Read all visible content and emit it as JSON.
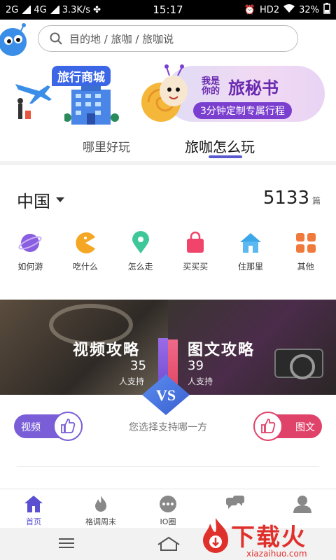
{
  "status_bar": {
    "network": "2G",
    "network2": "4G",
    "speed": "3.3K/s",
    "time": "15:17",
    "hd": "HD2",
    "battery": "32%"
  },
  "search": {
    "placeholder": "目的地 / 旅咖 / 旅咖说"
  },
  "banner": {
    "shop_label": "旅行商城",
    "secretary_small": "我是你的",
    "secretary_big": "旅秘书",
    "secretary_sub": "3分钟定制专属行程"
  },
  "tabs": [
    {
      "label": "哪里好玩",
      "active": false
    },
    {
      "label": "旅咖怎么玩",
      "active": true
    }
  ],
  "region": {
    "label": "中国",
    "count": "5133",
    "unit": "篇"
  },
  "categories": [
    {
      "label": "如何游",
      "icon": "planet-icon",
      "color": "#8a5ee0"
    },
    {
      "label": "吃什么",
      "icon": "pacman-icon",
      "color": "#f5a623"
    },
    {
      "label": "怎么走",
      "icon": "location-pin-icon",
      "color": "#3ec89a"
    },
    {
      "label": "买买买",
      "icon": "shopping-bag-icon",
      "color": "#f0446a"
    },
    {
      "label": "住那里",
      "icon": "house-icon",
      "color": "#3ba6e8"
    },
    {
      "label": "其他",
      "icon": "grid-icon",
      "color": "#f07a3c"
    }
  ],
  "versus": {
    "left_title": "视频攻略",
    "left_count": "35",
    "left_support": "人支持",
    "right_title": "图文攻略",
    "right_count": "39",
    "right_support": "人支持",
    "badge": "VS"
  },
  "choose": {
    "video_label": "视频",
    "image_label": "图文",
    "prompt": "您选择支持哪一方"
  },
  "bottom_nav": [
    {
      "label": "首页",
      "icon": "home-icon",
      "active": true
    },
    {
      "label": "格调周末",
      "icon": "flame-icon",
      "active": false
    },
    {
      "label": "IO圈",
      "icon": "chat-dots-icon",
      "active": false
    },
    {
      "label": "",
      "icon": "messages-icon",
      "active": false
    },
    {
      "label": "",
      "icon": "user-icon",
      "active": false
    }
  ],
  "watermark": {
    "text": "下载火",
    "url": "xiazaihuo.com"
  },
  "colors": {
    "accent": "#5a4fd0",
    "video": "#7a5ed8",
    "image": "#e0436a"
  }
}
